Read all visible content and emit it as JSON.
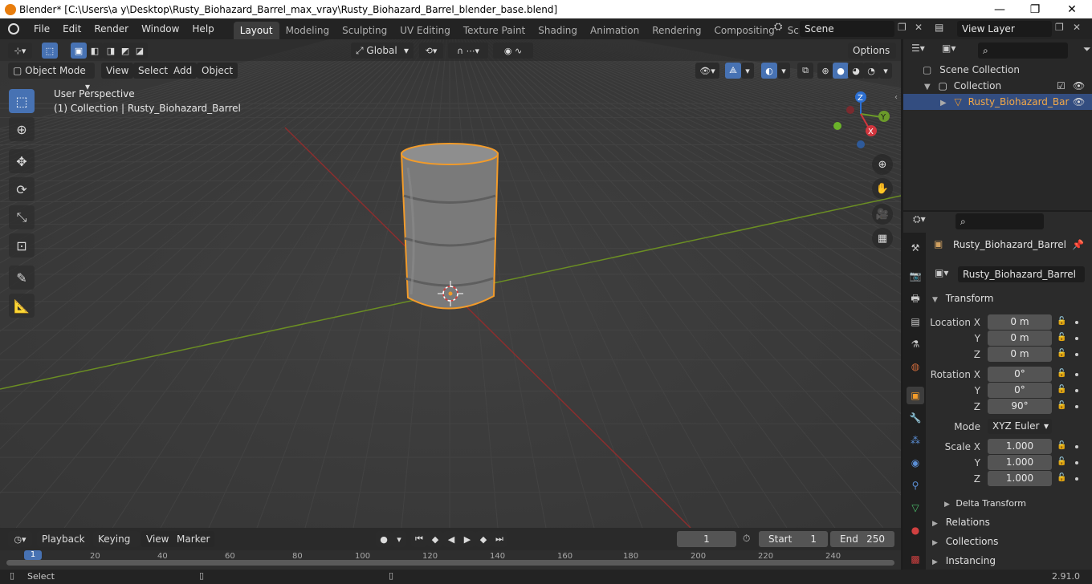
{
  "window": {
    "title": "Blender* [C:\\Users\\a y\\Desktop\\Rusty_Biohazard_Barrel_max_vray\\Rusty_Biohazard_Barrel_blender_base.blend]",
    "minimize": "—",
    "maximize": "❐",
    "close": "✕"
  },
  "menu": [
    "File",
    "Edit",
    "Render",
    "Window",
    "Help"
  ],
  "workspaces": [
    "Layout",
    "Modeling",
    "Sculpting",
    "UV Editing",
    "Texture Paint",
    "Shading",
    "Animation",
    "Rendering",
    "Compositing",
    "Scripting"
  ],
  "workspace_add": "+",
  "scene": {
    "value": "Scene"
  },
  "view_layer": {
    "value": "View Layer"
  },
  "viewport": {
    "transform_orientation": "Global",
    "options_label": "Options",
    "mode": "Object Mode",
    "header_menu": [
      "View",
      "Select",
      "Add",
      "Object"
    ],
    "perspective_text": "User Perspective",
    "collection_text": "(1) Collection | Rusty_Biohazard_Barrel",
    "gizmo": {
      "z": "Z",
      "y": "Y",
      "x": "X"
    }
  },
  "outliner": {
    "scene_collection": "Scene Collection",
    "collection": "Collection",
    "object": "Rusty_Biohazard_Bar"
  },
  "properties": {
    "object_name_header": "Rusty_Biohazard_Barrel",
    "object_name_field": "Rusty_Biohazard_Barrel",
    "transform_title": "Transform",
    "location": {
      "label": "Location X",
      "x": "0 m",
      "y": "0 m",
      "z": "0 m"
    },
    "rotation": {
      "label": "Rotation X",
      "x": "0°",
      "y": "0°",
      "z": "90°"
    },
    "mode_label": "Mode",
    "mode_value": "XYZ Euler",
    "scale": {
      "label": "Scale X",
      "x": "1.000",
      "y": "1.000",
      "z": "1.000"
    },
    "axis_y": "Y",
    "axis_z": "Z",
    "delta_transform": "Delta Transform",
    "sections": [
      "Relations",
      "Collections",
      "Instancing"
    ]
  },
  "timeline": {
    "menu": [
      "Playback",
      "Keying",
      "View",
      "Marker"
    ],
    "current_frame": "1",
    "start_label": "Start",
    "start_value": "1",
    "end_label": "End",
    "end_value": "250",
    "ruler_marks": [
      "1",
      "20",
      "40",
      "60",
      "80",
      "100",
      "120",
      "140",
      "160",
      "180",
      "200",
      "220",
      "240"
    ]
  },
  "status": {
    "left": "Select",
    "version": "2.91.0"
  },
  "colors": {
    "accent": "#4772b3",
    "selection": "#f29b2a",
    "x_axis": "#8b2e2e",
    "y_axis": "#6b8e23"
  }
}
